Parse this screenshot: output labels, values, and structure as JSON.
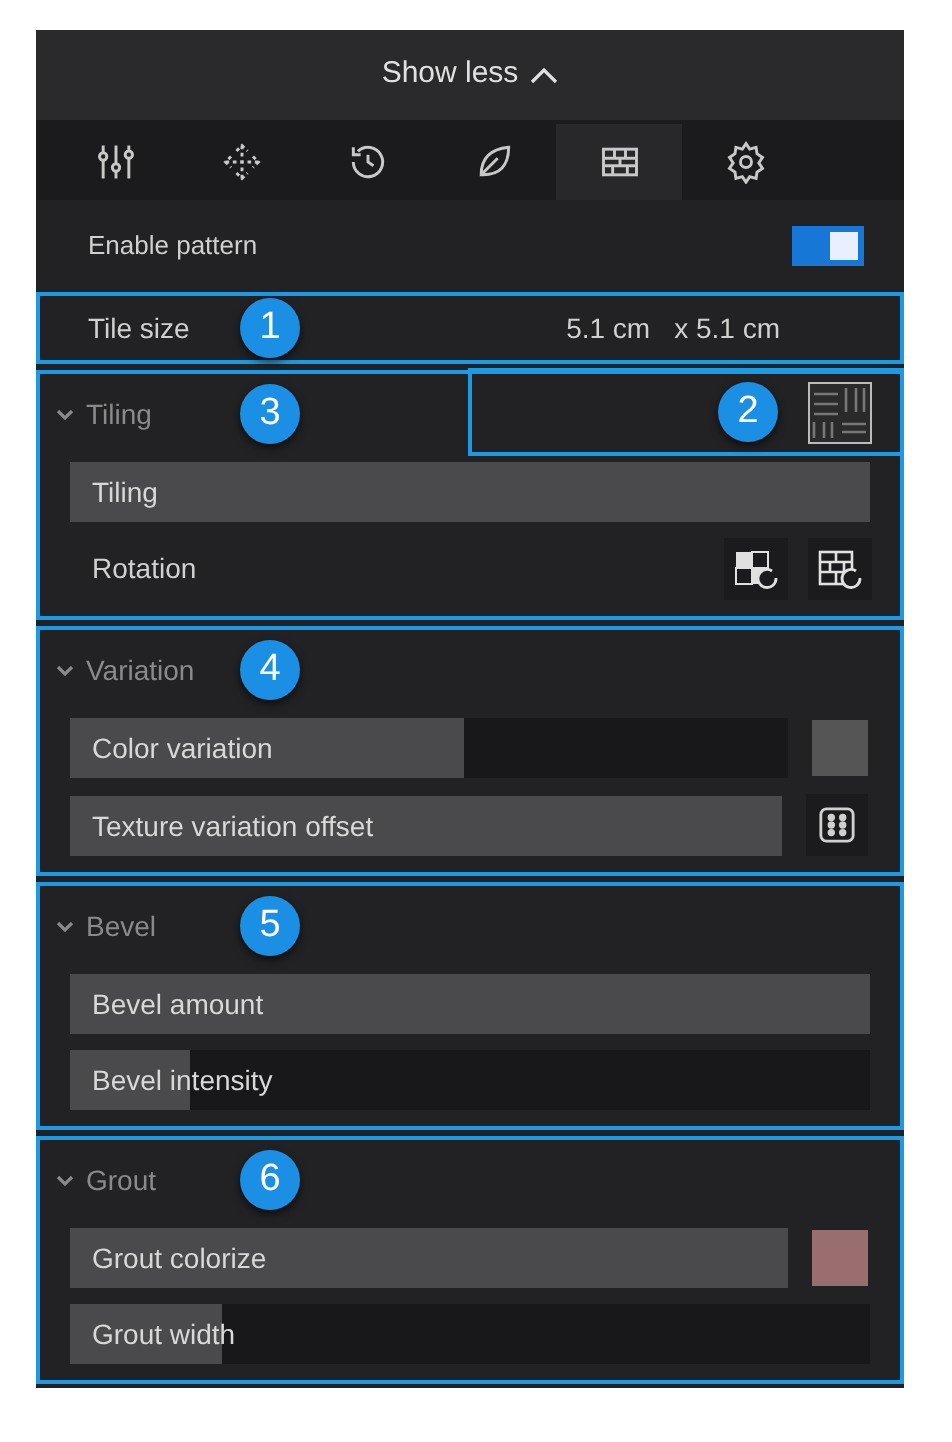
{
  "header": {
    "label": "Show less",
    "expanded": true
  },
  "tabs": [
    {
      "kind": "sliders",
      "selected": false
    },
    {
      "kind": "move",
      "selected": false
    },
    {
      "kind": "history",
      "selected": false
    },
    {
      "kind": "leaf",
      "selected": false
    },
    {
      "kind": "bricks",
      "selected": true
    },
    {
      "kind": "gear",
      "selected": false
    }
  ],
  "enable_pattern": {
    "label": "Enable pattern",
    "on": true
  },
  "tile_size": {
    "label": "Tile size",
    "callout": "1",
    "width": "5.1 cm",
    "height": "x 5.1 cm"
  },
  "pattern": {
    "callout": "2"
  },
  "sections": [
    {
      "title": "Tiling",
      "callout": "3",
      "expanded": true,
      "rows": [
        {
          "kind": "slider",
          "label": "Tiling",
          "level": 1
        },
        {
          "kind": "rotation",
          "label": "Rotation"
        }
      ]
    },
    {
      "title": "Variation",
      "callout": "4",
      "expanded": true,
      "rows": [
        {
          "kind": "swatch",
          "label": "Color variation",
          "level": 0.55,
          "color": "#555555"
        },
        {
          "kind": "dice",
          "label": "Texture variation offset",
          "level": 1
        }
      ]
    },
    {
      "title": "Bevel",
      "callout": "5",
      "expanded": true,
      "rows": [
        {
          "kind": "slider",
          "label": "Bevel amount",
          "level": 1
        },
        {
          "kind": "slider",
          "label": "Bevel intensity",
          "level": 0.15
        }
      ]
    },
    {
      "title": "Grout",
      "callout": "6",
      "expanded": true,
      "rows": [
        {
          "kind": "swatch",
          "label": "Grout colorize",
          "level": 1,
          "color": "#9a6e6e"
        },
        {
          "kind": "slider",
          "label": "Grout width",
          "level": 0.19
        }
      ]
    }
  ]
}
